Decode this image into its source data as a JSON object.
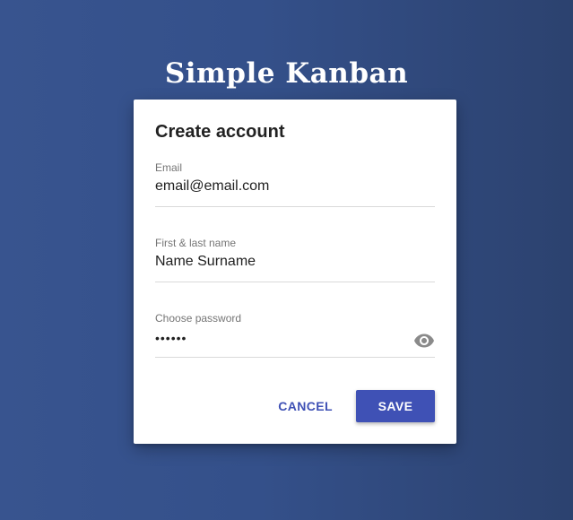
{
  "app": {
    "title": "Simple Kanban"
  },
  "card": {
    "title": "Create account",
    "fields": [
      {
        "label": "Email",
        "value": "email@email.com"
      },
      {
        "label": "First & last name",
        "value": "Name Surname"
      },
      {
        "label": "Choose password",
        "value": "••••••"
      }
    ],
    "password_toggle_icon": "eye-icon",
    "actions": {
      "cancel_label": "CANCEL",
      "save_label": "SAVE"
    }
  },
  "colors": {
    "accent": "#3f51b5",
    "background": "#34508a"
  }
}
